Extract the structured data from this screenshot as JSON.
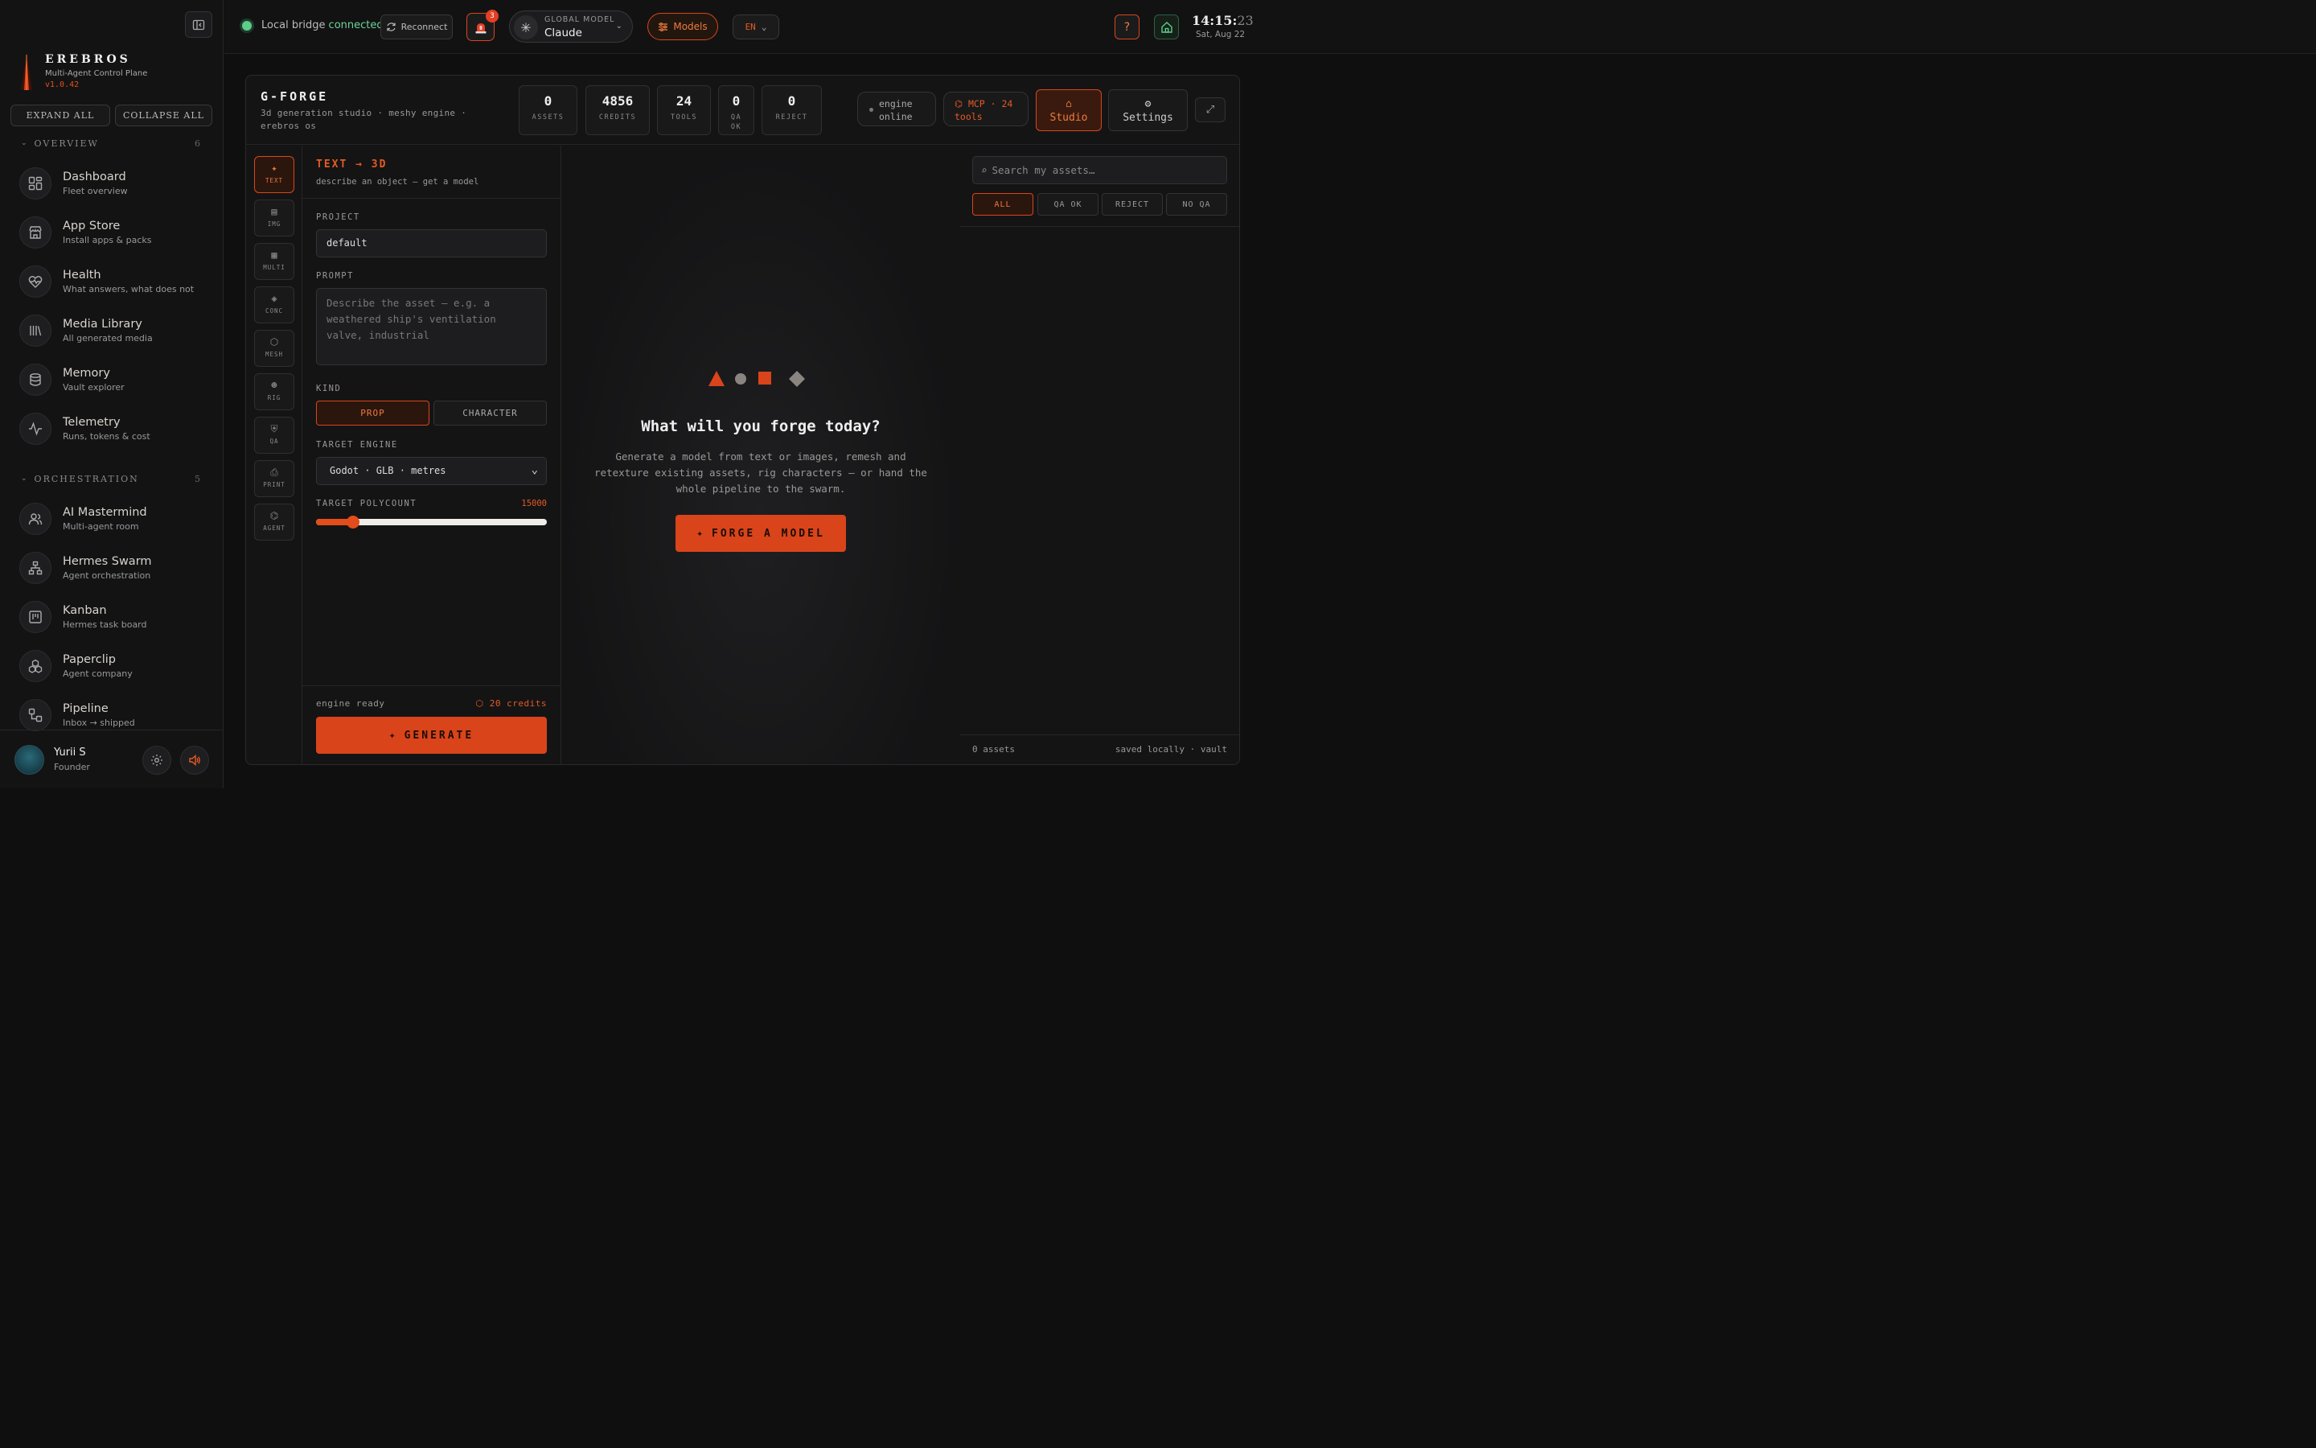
{
  "sidebar": {
    "brand": {
      "name": "EREBROS",
      "subtitle": "Multi-Agent Control Plane",
      "version": "v1.0.42"
    },
    "expand_all": "EXPAND ALL",
    "collapse_all": "COLLAPSE ALL",
    "sections": [
      {
        "title": "OVERVIEW",
        "count": "6"
      },
      {
        "title": "ORCHESTRATION",
        "count": "5"
      }
    ],
    "overview_items": [
      {
        "label": "Dashboard",
        "sub": "Fleet overview",
        "icon": "grid-icon"
      },
      {
        "label": "App Store",
        "sub": "Install apps & packs",
        "icon": "store-icon"
      },
      {
        "label": "Health",
        "sub": "What answers, what does not",
        "icon": "heart-pulse-icon"
      },
      {
        "label": "Media Library",
        "sub": "All generated media",
        "icon": "library-icon"
      },
      {
        "label": "Memory",
        "sub": "Vault explorer",
        "icon": "database-icon"
      },
      {
        "label": "Telemetry",
        "sub": "Runs, tokens & cost",
        "icon": "activity-icon"
      }
    ],
    "orchestration_items": [
      {
        "label": "AI Mastermind",
        "sub": "Multi-agent room",
        "icon": "users-icon"
      },
      {
        "label": "Hermes Swarm",
        "sub": "Agent orchestration",
        "icon": "network-icon"
      },
      {
        "label": "Kanban",
        "sub": "Hermes task board",
        "icon": "kanban-icon"
      },
      {
        "label": "Paperclip",
        "sub": "Agent company",
        "icon": "boxes-icon"
      },
      {
        "label": "Pipeline",
        "sub": "Inbox → shipped",
        "icon": "workflow-icon"
      }
    ],
    "user": {
      "name": "Yurii S",
      "role": "Founder"
    }
  },
  "topbar": {
    "bridge_label": "Local bridge",
    "bridge_status": "connected",
    "reconnect": "Reconnect",
    "alarm_count": "3",
    "global_model_label": "GLOBAL MODEL",
    "global_model_value": "Claude",
    "models": "Models",
    "lang": "EN",
    "help": "?",
    "clock_hm": "14:15:",
    "clock_s": "23",
    "date": "Sat, Aug 22"
  },
  "panel": {
    "title": "G-FORGE",
    "subtitle": "3d generation studio · meshy engine · erebros os",
    "stats": [
      {
        "value": "0",
        "label": "ASSETS"
      },
      {
        "value": "4856",
        "label": "CREDITS"
      },
      {
        "value": "24",
        "label": "TOOLS"
      },
      {
        "value": "0",
        "label": "QA OK"
      },
      {
        "value": "0",
        "label": "REJECT"
      }
    ],
    "engine_pill": "engine online",
    "mcp_pill": "⌬ MCP · 24 tools",
    "studio": "Studio",
    "settings": "Settings",
    "tools": [
      {
        "glyph": "✦",
        "label": "TEXT"
      },
      {
        "glyph": "▤",
        "label": "IMG"
      },
      {
        "glyph": "▦",
        "label": "MULTI"
      },
      {
        "glyph": "◈",
        "label": "CONC"
      },
      {
        "glyph": "⬡",
        "label": "MESH"
      },
      {
        "glyph": "☻",
        "label": "RIG"
      },
      {
        "glyph": "⛨",
        "label": "QA"
      },
      {
        "glyph": "⎙",
        "label": "PRINT"
      },
      {
        "glyph": "⌬",
        "label": "AGENT"
      }
    ],
    "form": {
      "title": "TEXT → 3D",
      "subtitle": "describe an object — get a model",
      "project_label": "PROJECT",
      "project_value": "default",
      "prompt_label": "PROMPT",
      "prompt_placeholder": "Describe the asset — e.g. a weathered ship's ventilation valve, industrial",
      "kind_label": "KIND",
      "kind_prop": "PROP",
      "kind_character": "CHARACTER",
      "engine_label": "TARGET ENGINE",
      "engine_value": "Godot · GLB · metres",
      "poly_label": "TARGET POLYCOUNT",
      "poly_value": "15000",
      "poly_fraction": 0.16,
      "status": "engine ready",
      "cost": "⬡ 20 credits",
      "generate": "GENERATE"
    },
    "canvas": {
      "title": "What will you forge today?",
      "desc": "Generate a model from text or images, remesh and retexture existing assets, rig characters — or hand the whole pipeline to the swarm.",
      "cta": "FORGE A MODEL"
    },
    "assets": {
      "search_placeholder": "Search my assets…",
      "filters": [
        "ALL",
        "QA OK",
        "REJECT",
        "NO QA"
      ],
      "count": "0 assets",
      "saved": "saved locally · vault"
    }
  },
  "colors": {
    "accent": "#d9441a",
    "success": "#5ccc8a",
    "background": "#0f0f10"
  }
}
